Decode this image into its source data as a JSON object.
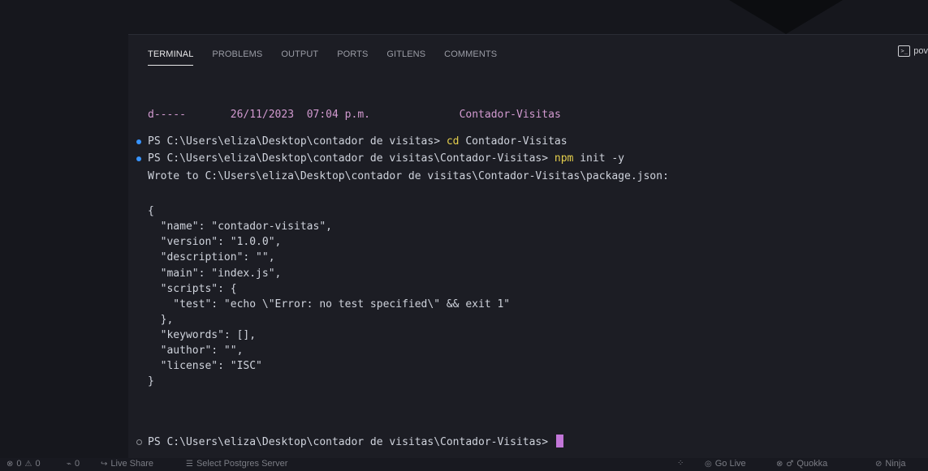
{
  "panel": {
    "tabs": [
      {
        "label": "TERMINAL",
        "active": true
      },
      {
        "label": "PROBLEMS"
      },
      {
        "label": "OUTPUT"
      },
      {
        "label": "PORTS"
      },
      {
        "label": "GITLENS"
      },
      {
        "label": "COMMENTS"
      }
    ],
    "shell_label": "pov",
    "shell_icon": "terminal-icon"
  },
  "terminal": {
    "dir_entry": {
      "mode": "d-----",
      "date": "26/11/2023",
      "time": "07:04 p.m.",
      "name": "Contador-Visitas"
    },
    "cmd1": {
      "prompt": "PS C:\\Users\\eliza\\Desktop\\contador de visitas> ",
      "command": "cd",
      "args": " Contador-Visitas"
    },
    "cmd2": {
      "prompt": "PS C:\\Users\\eliza\\Desktop\\contador de visitas\\Contador-Visitas> ",
      "command": "npm",
      "args": " init -y"
    },
    "wrote": "Wrote to C:\\Users\\eliza\\Desktop\\contador de visitas\\Contador-Visitas\\package.json:",
    "json_lines": [
      "{",
      "  \"name\": \"contador-visitas\",",
      "  \"version\": \"1.0.0\",",
      "  \"description\": \"\",",
      "  \"main\": \"index.js\",",
      "  \"scripts\": {",
      "    \"test\": \"echo \\\"Error: no test specified\\\" && exit 1\"",
      "  },",
      "  \"keywords\": [],",
      "  \"author\": \"\",",
      "  \"license\": \"ISC\"",
      "}"
    ],
    "final_prompt": "PS C:\\Users\\eliza\\Desktop\\contador de visitas\\Contador-Visitas> ",
    "prompt_dot_color": "#3794ff",
    "cursor_color": "#c276d8"
  },
  "status_bar": {
    "errors": "0",
    "warnings": "0",
    "ports": "0",
    "live_share": "Live Share",
    "postgres": "Select Postgres Server",
    "go_live": "Go Live",
    "quokka": "Quokka",
    "ninja": "Ninja"
  }
}
